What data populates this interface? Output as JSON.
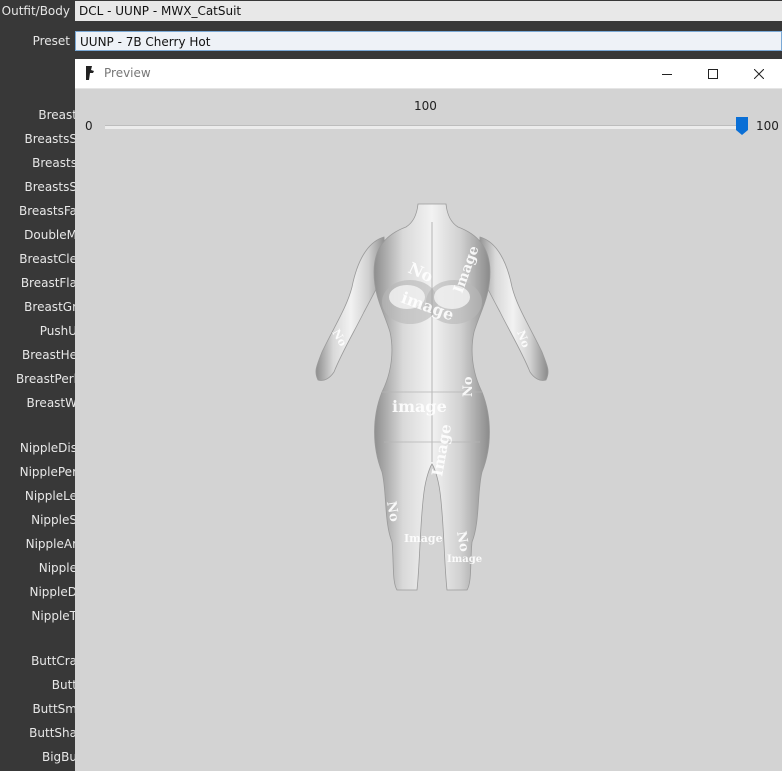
{
  "top_bar": {
    "outfit_label": "Outfit/Body",
    "outfit_value": "DCL - UUNP - MWX_CatSuit",
    "preset_label": "Preset",
    "preset_value": "UUNP - 7B Cherry Hot"
  },
  "slider_labels": [
    {
      "label": "Breast"
    },
    {
      "label": "BreastsS"
    },
    {
      "label": "Breasts"
    },
    {
      "label": "BreastsS"
    },
    {
      "label": "BreastsFa"
    },
    {
      "label": "DoubleM"
    },
    {
      "label": "BreastCle"
    },
    {
      "label": "BreastFla"
    },
    {
      "label": "BreastGr"
    },
    {
      "label": "PushU"
    },
    {
      "label": "BreastHe"
    },
    {
      "label": "BreastPerl"
    },
    {
      "label": "BreastW"
    },
    {
      "label": "NippleDis"
    },
    {
      "label": "NipplePer"
    },
    {
      "label": "NippleLe"
    },
    {
      "label": "NippleS"
    },
    {
      "label": "NippleAr"
    },
    {
      "label": "Nipple"
    },
    {
      "label": "NippleD"
    },
    {
      "label": "NippleT"
    },
    {
      "label": "ButtCra"
    },
    {
      "label": "Butt"
    },
    {
      "label": "ButtSm"
    },
    {
      "label": "ButtSha"
    },
    {
      "label": "BigBu"
    }
  ],
  "preview": {
    "title": "Preview",
    "slider": {
      "value": "100",
      "min_label": "0",
      "max_label": "100",
      "fraction": 1.0
    },
    "texture_words": [
      "No",
      "image",
      "No",
      "Image",
      "No",
      "image",
      "No",
      "Image",
      "No",
      "Image",
      "No",
      "Image"
    ]
  },
  "colors": {
    "accent": "#0a6fd6",
    "panel_bg": "#383838",
    "preview_bg": "#d3d3d3"
  },
  "icons": [
    "app-icon",
    "minimize-icon",
    "maximize-icon",
    "close-icon"
  ]
}
